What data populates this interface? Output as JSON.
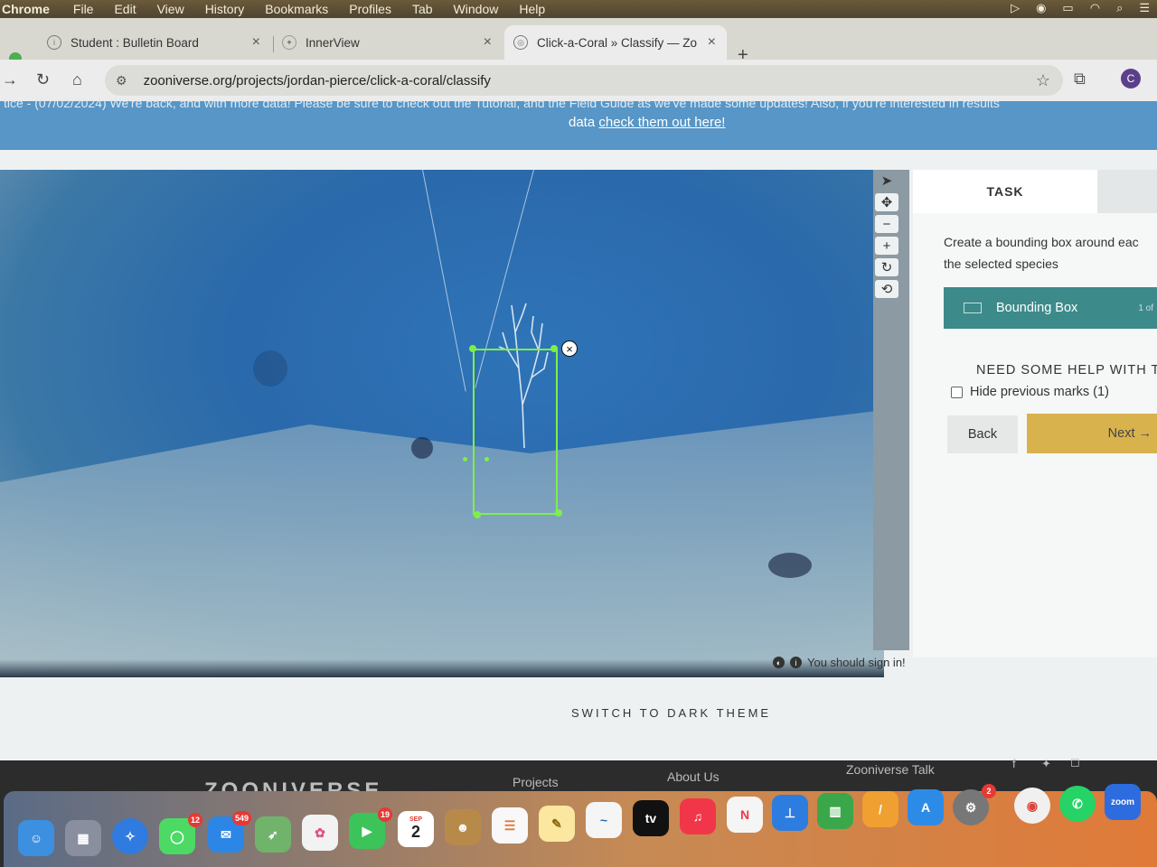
{
  "menubar": {
    "app": "Chrome",
    "items": [
      "File",
      "Edit",
      "View",
      "History",
      "Bookmarks",
      "Profiles",
      "Tab",
      "Window",
      "Help"
    ]
  },
  "tabs": [
    {
      "label": "Student : Bulletin Board"
    },
    {
      "label": "InnerView"
    },
    {
      "label": "Click-a-Coral » Classify — Zo"
    }
  ],
  "address": {
    "url": "zooniverse.org/projects/jordan-pierce/click-a-coral/classify",
    "profile_initial": "C"
  },
  "banner": {
    "line1": "tice - (07/02/2024) We're back, and with more data! Please be sure to check out the Tutorial, and the Field Guide as we've made some updates! Also, if you're interested in results",
    "line2_prefix": "data ",
    "line2_link": "check them out here!"
  },
  "viewer": {
    "tools": [
      "pointer",
      "move",
      "zoom-out",
      "zoom-in",
      "rotate",
      "reset"
    ]
  },
  "panel": {
    "task_tab": "TASK",
    "instruction": "Create a bounding box around eac the selected species",
    "tool_label": "Bounding Box",
    "tool_count": "1 of",
    "need_help": "NEED SOME HELP WITH T",
    "hide_prev": "Hide previous marks (1)",
    "back": "Back",
    "next": "Next →"
  },
  "signin": "You should sign in!",
  "dark_theme": "SWITCH TO DARK THEME",
  "footer": {
    "logo": "ZOONIVERSE",
    "links": [
      "Projects",
      "About Us",
      "Zooniverse Talk"
    ]
  },
  "dock": {
    "badges": {
      "messages": "12",
      "mail": "549",
      "facetime": "19",
      "settings": "2"
    },
    "calendar": {
      "month": "SEP",
      "day": "2"
    },
    "tv": "tv",
    "zoom": "zoom"
  }
}
